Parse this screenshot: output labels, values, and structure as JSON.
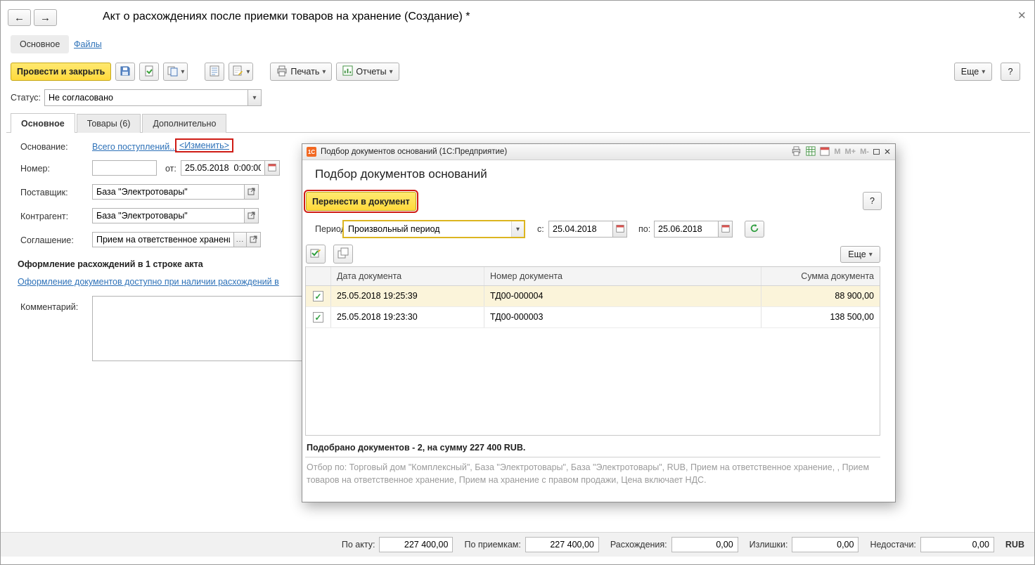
{
  "colors": {
    "accent_yellow": "#ffd93b",
    "annotation_red": "#cf1c15",
    "link_blue": "#2d71b8",
    "check_green": "#2e9e3e",
    "selected_row": "#fbf4da"
  },
  "icons": {
    "back": "←",
    "forward": "→",
    "close": "✕",
    "dropdown": "▾",
    "help": "?",
    "ellipsis": "...",
    "check": "✓"
  },
  "window": {
    "title": "Акт о расхождениях после приемки товаров на хранение (Создание) *"
  },
  "section_tabs": {
    "main": "Основное",
    "files": "Файлы"
  },
  "toolbar": {
    "post_close": "Провести и закрыть",
    "print": "Печать",
    "reports": "Отчеты",
    "more": "Еще",
    "help": "?"
  },
  "status": {
    "label": "Статус:",
    "value": "Не согласовано"
  },
  "tabs": [
    {
      "label": "Основное"
    },
    {
      "label": "Товары (6)"
    },
    {
      "label": "Дополнительно"
    }
  ],
  "form": {
    "basis_label": "Основание:",
    "basis_link": "Всего поступлений...",
    "basis_change": "<Изменить>",
    "number_label": "Номер:",
    "from_label": "от:",
    "date_value": "25.05.2018  0:00:00",
    "supplier_label": "Поставщик:",
    "supplier_value": "База \"Электротовары\"",
    "counterparty_label": "Контрагент:",
    "counterparty_value": "База \"Электротовары\"",
    "agreement_label": "Соглашение:",
    "agreement_value": "Прием на ответственное хранение",
    "reg_note_bold": "Оформление расхождений в 1 строке акта",
    "reg_note_link": "Оформление документов доступно при наличии расхождений в",
    "comment_label": "Комментарий:"
  },
  "dialog": {
    "title": "Подбор документов оснований  (1С:Предприятие)",
    "logo": "1С",
    "mem_m": "M",
    "mem_mplus": "M+",
    "mem_mminus": "M-",
    "heading": "Подбор документов оснований",
    "transfer_button": "Перенести в документ",
    "help": "?",
    "period": {
      "label": "Период:",
      "value": "Произвольный период",
      "from_label": "с:",
      "from": "25.04.2018",
      "to_label": "по:",
      "to": "25.06.2018"
    },
    "more": "Еще",
    "table": {
      "col_date": "Дата документа",
      "col_number": "Номер документа",
      "col_sum": "Сумма документа",
      "rows": [
        {
          "date": "25.05.2018 19:25:39",
          "number": "ТД00-000004",
          "sum": "88 900,00"
        },
        {
          "date": "25.05.2018 19:23:30",
          "number": "ТД00-000003",
          "sum": "138 500,00"
        }
      ]
    },
    "summary": "Подобрано документов - 2, на сумму 227 400 RUB.",
    "filter": "Отбор по: Торговый дом \"Комплексный\", База \"Электротовары\", База \"Электротовары\",  RUB, Прием на ответственное хранение, , Прием товаров на ответственное хранение, Прием на хранение с правом продажи, Цена включает НДС."
  },
  "footer": {
    "act_label": "По акту:",
    "act": "227 400,00",
    "receipts_label": "По приемкам:",
    "receipts": "227 400,00",
    "disc_label": "Расхождения:",
    "disc": "0,00",
    "surplus_label": "Излишки:",
    "surplus": "0,00",
    "shortage_label": "Недостачи:",
    "shortage": "0,00",
    "currency": "RUB"
  }
}
